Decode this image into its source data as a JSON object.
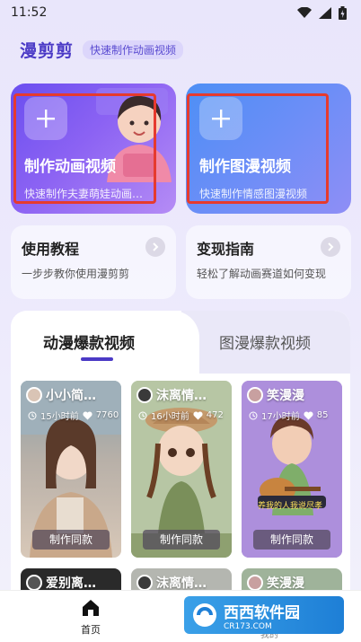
{
  "status_bar": {
    "time": "11:52"
  },
  "header": {
    "app_name": "漫剪剪",
    "tagline": "快速制作动画视频"
  },
  "create_cards": [
    {
      "title": "制作动画视频",
      "subtitle": "快速制作夫妻萌娃动画…"
    },
    {
      "title": "制作图漫视频",
      "subtitle": "快速制作情感图漫视频"
    }
  ],
  "guide_cards": [
    {
      "title": "使用教程",
      "subtitle": "一步步教你使用漫剪剪"
    },
    {
      "title": "变现指南",
      "subtitle": "轻松了解动画赛道如何变现"
    }
  ],
  "tabs": [
    {
      "label": "动漫爆款视频",
      "active": true
    },
    {
      "label": "图漫爆款视频",
      "active": false
    }
  ],
  "videos": [
    {
      "author": "小小简…",
      "time": "15小时前",
      "likes": "7760",
      "button": "制作同款"
    },
    {
      "author": "沫离情…",
      "time": "16小时前",
      "likes": "472",
      "button": "制作同款"
    },
    {
      "author": "笑漫漫",
      "time": "17小时前",
      "likes": "85",
      "button": "制作同款",
      "caption": "养我的人我说尽孝"
    }
  ],
  "videos_row2": [
    {
      "author": "爱别离…"
    },
    {
      "author": "沫离情…"
    },
    {
      "author": "笑漫漫"
    }
  ],
  "bottom_nav": {
    "home": "首页",
    "mine": "我的"
  },
  "watermark": {
    "brand": "西西软件园",
    "url": "CR173.COM"
  },
  "colors": {
    "accent": "#4b3ac6",
    "highlight_frame": "#e63a2e"
  }
}
